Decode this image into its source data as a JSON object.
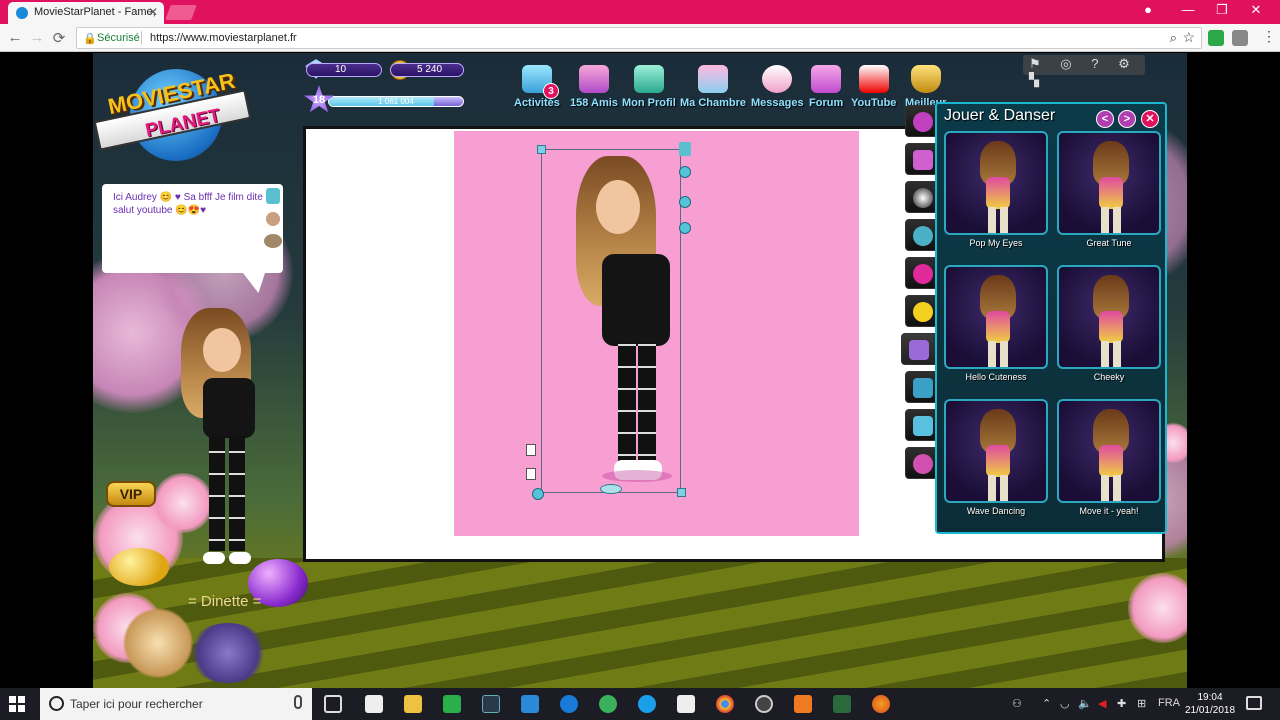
{
  "browser": {
    "tab_title": "MovieStarPlanet - Fame,",
    "tab_close": "✕",
    "window_controls": {
      "profile": "●",
      "minimize": "—",
      "maximize": "❐",
      "close": "✕"
    },
    "back": "←",
    "forward": "→",
    "reload": "⟳",
    "secure_label": "Sécurisé",
    "url": "https://www.moviestarplanet.fr",
    "menu": "⋮",
    "accent": "#e0125f"
  },
  "game": {
    "logo": {
      "line1": "MOVIESTAR",
      "line2": "PLANET"
    },
    "stats": {
      "diamonds": "10",
      "coins": "5 240",
      "level": "18",
      "fame": "1 061 004",
      "fame_progress": 0.78
    },
    "nav": [
      {
        "label": "Activités",
        "icon": "activities-icon"
      },
      {
        "label": "158 Amis",
        "icon": "friends-icon"
      },
      {
        "label": "Mon Profil",
        "icon": "profile-icon"
      },
      {
        "label": "Ma Chambre",
        "icon": "room-icon"
      },
      {
        "label": "Messages",
        "icon": "messages-icon"
      },
      {
        "label": "Forum",
        "icon": "forum-icon"
      },
      {
        "label": "YouTube",
        "icon": "youtube-icon"
      },
      {
        "label": "Meilleur",
        "icon": "trophy-icon"
      }
    ],
    "activities_badge": "3",
    "tools_icons": "⚑ ◎ ? ⚙ ▚",
    "chat": {
      "text": "Ici Audrey 😊 ♥ Sa bfff Je film dite salut youtube 😊😍♥"
    },
    "vip_label": "VIP",
    "username": "= Dinette =",
    "panel": {
      "title": "Jouer & Danser",
      "prev": "<",
      "next": ">",
      "close": "✕",
      "items": [
        {
          "label": "Pop My Eyes"
        },
        {
          "label": "Great Tune"
        },
        {
          "label": "Hello Cuteness"
        },
        {
          "label": "Cheeky"
        },
        {
          "label": "Wave Dancing"
        },
        {
          "label": "Move it - yeah!"
        }
      ]
    },
    "toolbar_icons": [
      "paw-icon",
      "glasses-icon",
      "soccer-icon",
      "alien-icon",
      "heart-icon",
      "smiley-icon",
      "dance-icon",
      "pose-icon",
      "skateboard-icon",
      "pet-icon"
    ]
  },
  "taskbar": {
    "search_placeholder": "Taper ici pour rechercher",
    "language": "FRA",
    "time": "19:04",
    "date": "21/01/2018"
  }
}
